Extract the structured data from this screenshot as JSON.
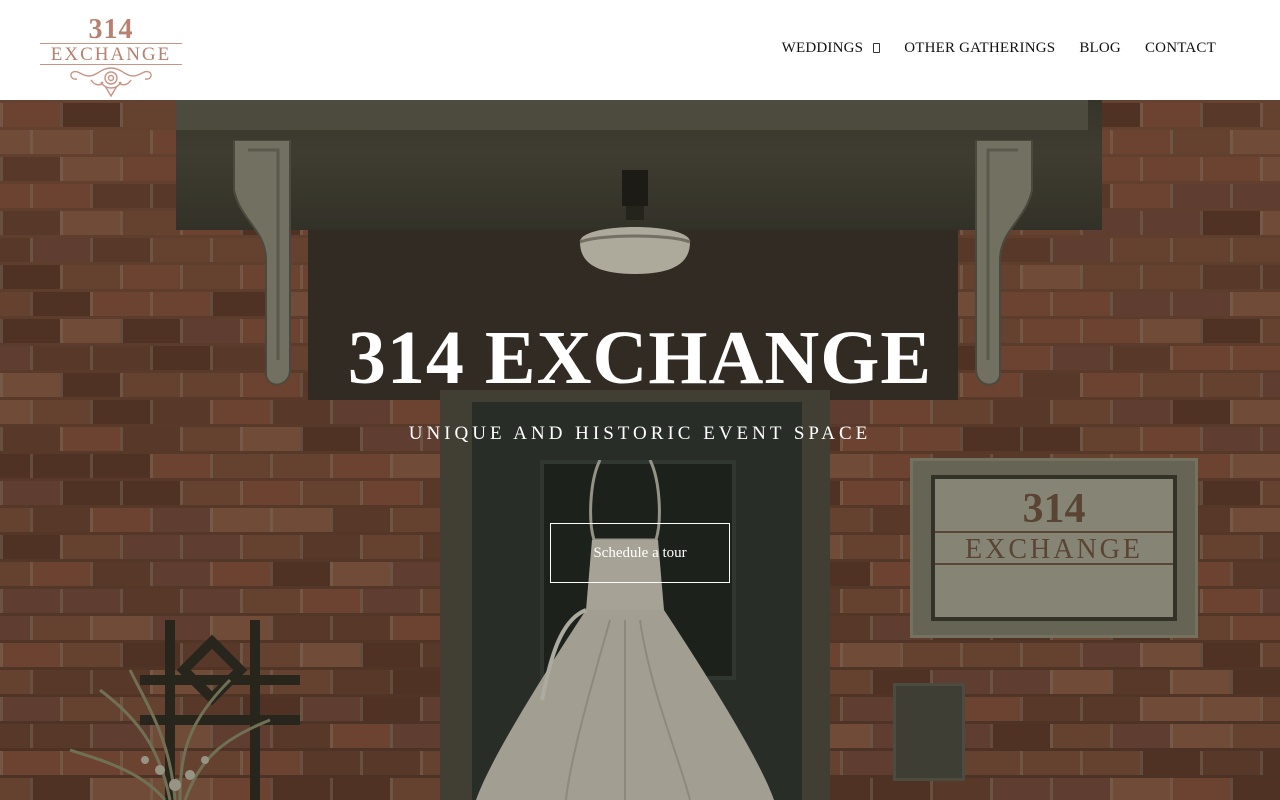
{
  "logo": {
    "number": "314",
    "word": "EXCHANGE",
    "color": "#b88070"
  },
  "nav": {
    "items": [
      {
        "label": "WEDDINGS",
        "has_dropdown": true
      },
      {
        "label": "OTHER GATHERINGS"
      },
      {
        "label": "BLOG"
      },
      {
        "label": "CONTACT"
      }
    ]
  },
  "hero": {
    "title": "314 EXCHANGE",
    "subtitle": "UNIQUE AND HISTORIC EVENT SPACE",
    "cta_label": "Schedule a tour",
    "plaque_number": "314",
    "plaque_word": "EXCHANGE"
  },
  "colors": {
    "brick": "#6f4a36",
    "text_on_hero": "#ffffff",
    "header_bg": "#ffffff"
  }
}
